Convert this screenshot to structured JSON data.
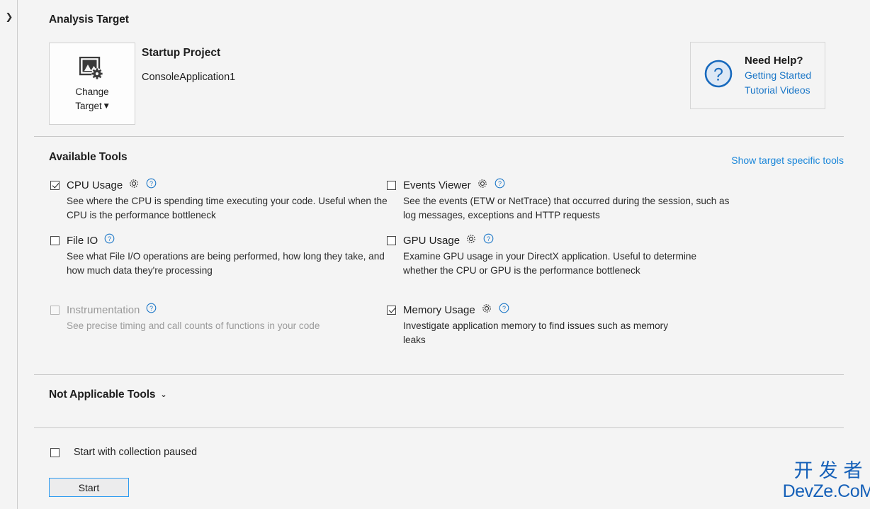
{
  "rail": {
    "expand_icon": "chevron-right-icon",
    "expand_glyph": "❯"
  },
  "analysis_target": {
    "title": "Analysis Target",
    "change_target": {
      "line1": "Change",
      "line2": "Target",
      "caret": "▼",
      "icon": "picture-settings-icon"
    },
    "project_label": "Startup Project",
    "project_name": "ConsoleApplication1"
  },
  "help": {
    "icon": "question-circle-icon",
    "title": "Need Help?",
    "links": [
      "Getting Started",
      "Tutorial Videos"
    ],
    "link_color": "#1a76c7"
  },
  "available_tools": {
    "title": "Available Tools",
    "show_target_specific_link": "Show target specific tools",
    "tools": [
      {
        "name": "CPU Usage",
        "checked": true,
        "enabled": true,
        "has_gear": true,
        "has_help": true,
        "description": "See where the CPU is spending time executing your code. Useful when the CPU is the performance bottleneck"
      },
      {
        "name": "File IO",
        "checked": false,
        "enabled": true,
        "has_gear": false,
        "has_help": true,
        "description": "See what File I/O operations are being performed, how long they take, and how much data they're processing"
      },
      {
        "name": "Instrumentation",
        "checked": false,
        "enabled": false,
        "has_gear": false,
        "has_help": true,
        "description": "See precise timing and call counts of functions in your code"
      },
      {
        "name": "Events Viewer",
        "checked": false,
        "enabled": true,
        "has_gear": true,
        "has_help": true,
        "description": "See the events (ETW or NetTrace) that occurred during the session, such as log messages, exceptions and HTTP requests"
      },
      {
        "name": "GPU Usage",
        "checked": false,
        "enabled": true,
        "has_gear": true,
        "has_help": true,
        "description": "Examine GPU usage in your DirectX application. Useful to determine whether the CPU or GPU is the performance bottleneck"
      },
      {
        "name": "Memory Usage",
        "checked": true,
        "enabled": true,
        "has_gear": true,
        "has_help": true,
        "description": "Investigate application memory to find issues such as memory leaks"
      }
    ]
  },
  "not_applicable": {
    "title": "Not Applicable Tools",
    "caret": "⌄",
    "caret_icon": "chevron-down-icon"
  },
  "footer": {
    "paused_checkbox_label": "Start with collection paused",
    "paused_checked": false,
    "start_button_label": "Start",
    "start_button_border_color": "#2e9bf0"
  },
  "watermark": {
    "chinese": "开发者",
    "latin": "DevZe.CoM",
    "color": "#1560b8"
  }
}
